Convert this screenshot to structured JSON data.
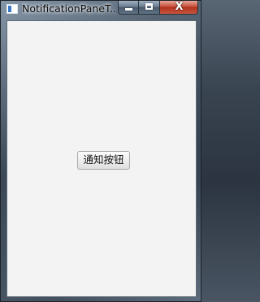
{
  "window": {
    "title": "NotificationPaneT...",
    "icon": "app-window-icon",
    "minimize_icon": "minimize-icon",
    "maximize_icon": "maximize-icon",
    "close_icon": "close-icon",
    "close_glyph": "X"
  },
  "content": {
    "notify_button_label": "通知按钮"
  },
  "colors": {
    "client_background": "#f3f3f3",
    "close_button": "#c7503a"
  }
}
